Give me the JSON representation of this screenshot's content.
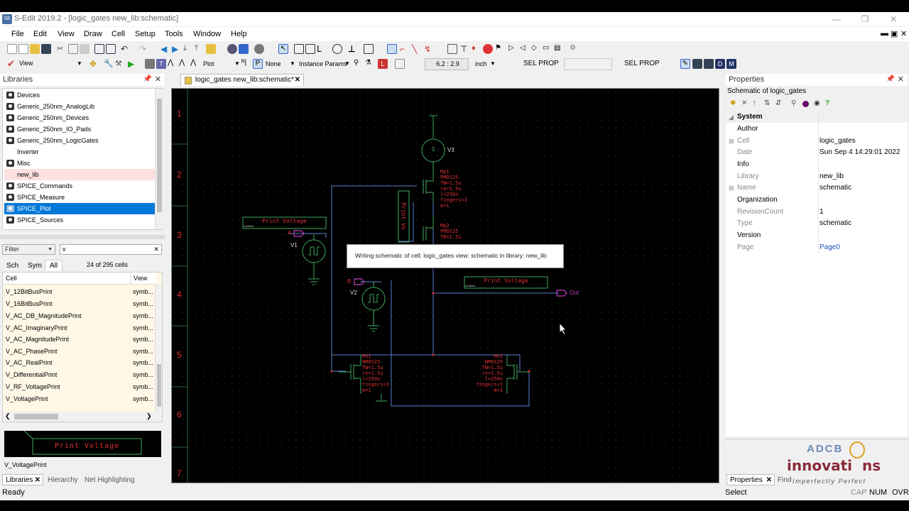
{
  "window": {
    "title": "S-Edit 2019.2 - [logic_gates new_lib:schematic]",
    "app_icon": "SE"
  },
  "menu": {
    "items": [
      "File",
      "Edit",
      "View",
      "Draw",
      "Cell",
      "Setup",
      "Tools",
      "Window",
      "Help"
    ]
  },
  "toolbar2": {
    "mode": "View",
    "plot": "Plot",
    "none": "None",
    "instance_params": "Instance Params",
    "coords": "6.2 : 2.9",
    "units": "inch",
    "sel_prop_1": "SEL PROP",
    "sel_prop_2": "SEL PROP"
  },
  "libraries": {
    "header": "Libraries",
    "items": [
      {
        "label": "Devices"
      },
      {
        "label": "Generic_250nm_AnalogLib"
      },
      {
        "label": "Generic_250nm_Devices"
      },
      {
        "label": "Generic_250nm_IO_Pads"
      },
      {
        "label": "Generic_250nm_LogicGates"
      },
      {
        "label": "Inverter"
      },
      {
        "label": "Misc"
      },
      {
        "label": "new_lib"
      },
      {
        "label": "SPICE_Commands"
      },
      {
        "label": "SPICE_Measure"
      },
      {
        "label": "SPICE_Plot"
      },
      {
        "label": "SPICE_Sources"
      }
    ],
    "filter_label": "Filter",
    "filter_value": "v",
    "view_tabs": [
      "Sch",
      "Sym",
      "All"
    ],
    "cell_count": "24 of 295 cells",
    "columns": [
      "Cell",
      "View"
    ],
    "cells": [
      {
        "cell": "V_12BitBusPrint",
        "view": "symb..."
      },
      {
        "cell": "V_16BitBusPrint",
        "view": "symb..."
      },
      {
        "cell": "V_AC_DB_MagnitudePrint",
        "view": "symb..."
      },
      {
        "cell": "V_AC_ImaginaryPrint",
        "view": "symb..."
      },
      {
        "cell": "V_AC_MagnitudePrint",
        "view": "symb..."
      },
      {
        "cell": "V_AC_PhasePrint",
        "view": "symb..."
      },
      {
        "cell": "V_AC_RealPrint",
        "view": "symb..."
      },
      {
        "cell": "V_DifferentialPrint",
        "view": "symb..."
      },
      {
        "cell": "V_RF_VoltagePrint",
        "view": "symb..."
      },
      {
        "cell": "V_VoltagePrint",
        "view": "symb..."
      }
    ],
    "preview_text": "Print Voltage",
    "preview_name": "V_VoltagePrint"
  },
  "bottom_tabs_left": [
    "Libraries",
    "Hierarchy",
    "Net Highlighting"
  ],
  "document": {
    "tab_label": "logic_gates new_lib:schematic*",
    "row_labels": [
      "1",
      "2",
      "3",
      "4",
      "5",
      "6",
      "7"
    ],
    "dialog_text": "Writing schematic of cell: logic_gates view: schematic in library: new_lib",
    "print_voltage_1": "Print Voltage",
    "print_voltage_2": "Print Voltage",
    "print_voltage_vertical": "Print Vo",
    "enabled": "enabled",
    "src_v1": "V1",
    "src_v2": "V2",
    "src_v3": "V3",
    "v3_value": "5",
    "pin_a": "A",
    "pin_b": "B",
    "pin_out": "Out",
    "mp1": [
      "Mp1",
      "PMOS25",
      "TW=1.5u",
      "re=1.5u",
      "l=250n",
      "fingers=1",
      "m=1"
    ],
    "mp2": [
      "Mp2",
      "PMOS25",
      "TW=1.5u"
    ],
    "mn1": [
      "Mn1",
      "NMOS25",
      "TW=1.5u",
      "re=1.5u",
      "l=250n",
      "fingers=1",
      "m=1"
    ],
    "mn2": [
      "Mn2",
      "NMOS25",
      "TW=1.5u",
      "re=1.5u",
      "l=250n",
      "fingers=1",
      "m=1"
    ]
  },
  "properties": {
    "header": "Properties",
    "subtitle": "Schematic of logic_gates",
    "rows": [
      {
        "key": "System",
        "value": "",
        "type": "section"
      },
      {
        "key": "Author",
        "value": "",
        "type": "bold"
      },
      {
        "key": "Cell",
        "value": "logic_gates",
        "type": "expand"
      },
      {
        "key": "Date",
        "value": "Sun Sep  4 14:29:01 2022",
        "type": "normal"
      },
      {
        "key": "Info",
        "value": "",
        "type": "bold"
      },
      {
        "key": "Library",
        "value": "new_lib",
        "type": "normal"
      },
      {
        "key": "Name",
        "value": "schematic",
        "type": "expand"
      },
      {
        "key": "Organization",
        "value": "",
        "type": "bold"
      },
      {
        "key": "RevisionCount",
        "value": "1",
        "type": "normal"
      },
      {
        "key": "Type",
        "value": "schematic",
        "type": "normal"
      },
      {
        "key": "Version",
        "value": "",
        "type": "bold"
      },
      {
        "key": "Page",
        "value": "Page0",
        "type": "link"
      }
    ],
    "bottom_tabs": [
      "Properties",
      "Find"
    ]
  },
  "status": {
    "left": "Ready",
    "mode": "Select",
    "caps": "CAP",
    "num": "NUM",
    "ovr": "OVR"
  },
  "logo": {
    "line1": "ADCB",
    "line2": "innovati",
    "line2b": "ns",
    "tagline": "Imperfectly Perfect"
  },
  "colors": {
    "accent": "#0078d7",
    "schematic_red": "#e03030",
    "wire_blue": "#5a7fd0",
    "symbol_green": "#40a860",
    "pin_magenta": "#c040c0"
  }
}
